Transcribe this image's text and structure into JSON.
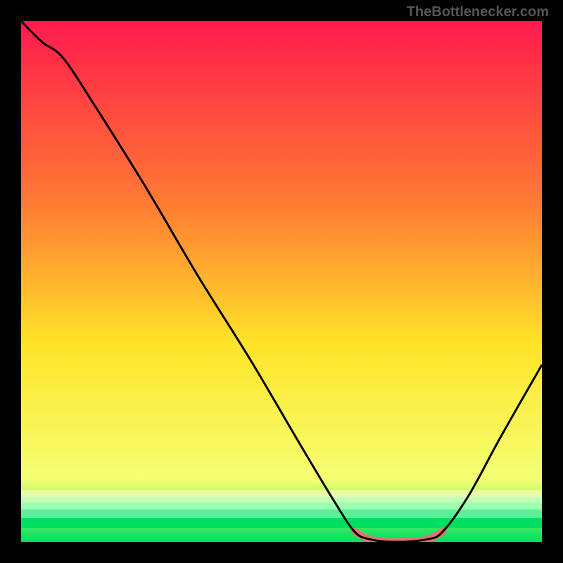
{
  "watermark": "TheBottlenecker.com",
  "chart_data": {
    "type": "line",
    "title": "",
    "xlabel": "",
    "ylabel": "",
    "xlim": [
      0,
      100
    ],
    "ylim": [
      0,
      100
    ],
    "gradient": {
      "top_color": "#ff1a4d",
      "mid_top_color": "#ff7b33",
      "mid_color": "#ffe428",
      "mid_bottom_color": "#f5ff74",
      "bottom_color": "#00e060"
    },
    "curve": [
      {
        "x": 0,
        "y": 100
      },
      {
        "x": 4,
        "y": 96
      },
      {
        "x": 8,
        "y": 93
      },
      {
        "x": 14,
        "y": 84
      },
      {
        "x": 24,
        "y": 68
      },
      {
        "x": 34,
        "y": 51
      },
      {
        "x": 44,
        "y": 35
      },
      {
        "x": 54,
        "y": 18
      },
      {
        "x": 60,
        "y": 8
      },
      {
        "x": 64,
        "y": 2
      },
      {
        "x": 67,
        "y": 0.5
      },
      {
        "x": 72,
        "y": 0
      },
      {
        "x": 78,
        "y": 0.5
      },
      {
        "x": 81,
        "y": 2
      },
      {
        "x": 86,
        "y": 9
      },
      {
        "x": 92,
        "y": 20
      },
      {
        "x": 100,
        "y": 34
      }
    ],
    "highlight_band": {
      "start_x": 64,
      "end_x": 81,
      "color": "#e57373"
    }
  }
}
